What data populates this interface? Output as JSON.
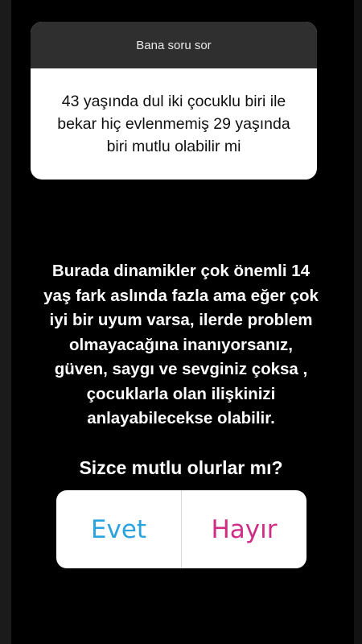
{
  "question_card": {
    "header": "Bana soru sor",
    "question": "43 yaşında dul iki çocuklu biri ile bekar hiç evlenmemiş 29 yaşında biri mutlu olabilir mi"
  },
  "answer": {
    "text": "Burada dinamikler çok önemli 14\nyaş fark aslında fazla ama eğer çok\niyi bir uyum varsa, ilerde problem\nolmayacağına inanıyorsanız,\ngüven, saygı ve sevginiz çoksa ,\nçocuklarla olan ilişkinizi\nanlayabilecekse olabilir."
  },
  "poll": {
    "question": "Sizce mutlu olurlar mı?",
    "options": [
      {
        "label": "Evet",
        "color": "#2aa3df"
      },
      {
        "label": "Hayır",
        "color": "#cf2d85"
      }
    ]
  }
}
